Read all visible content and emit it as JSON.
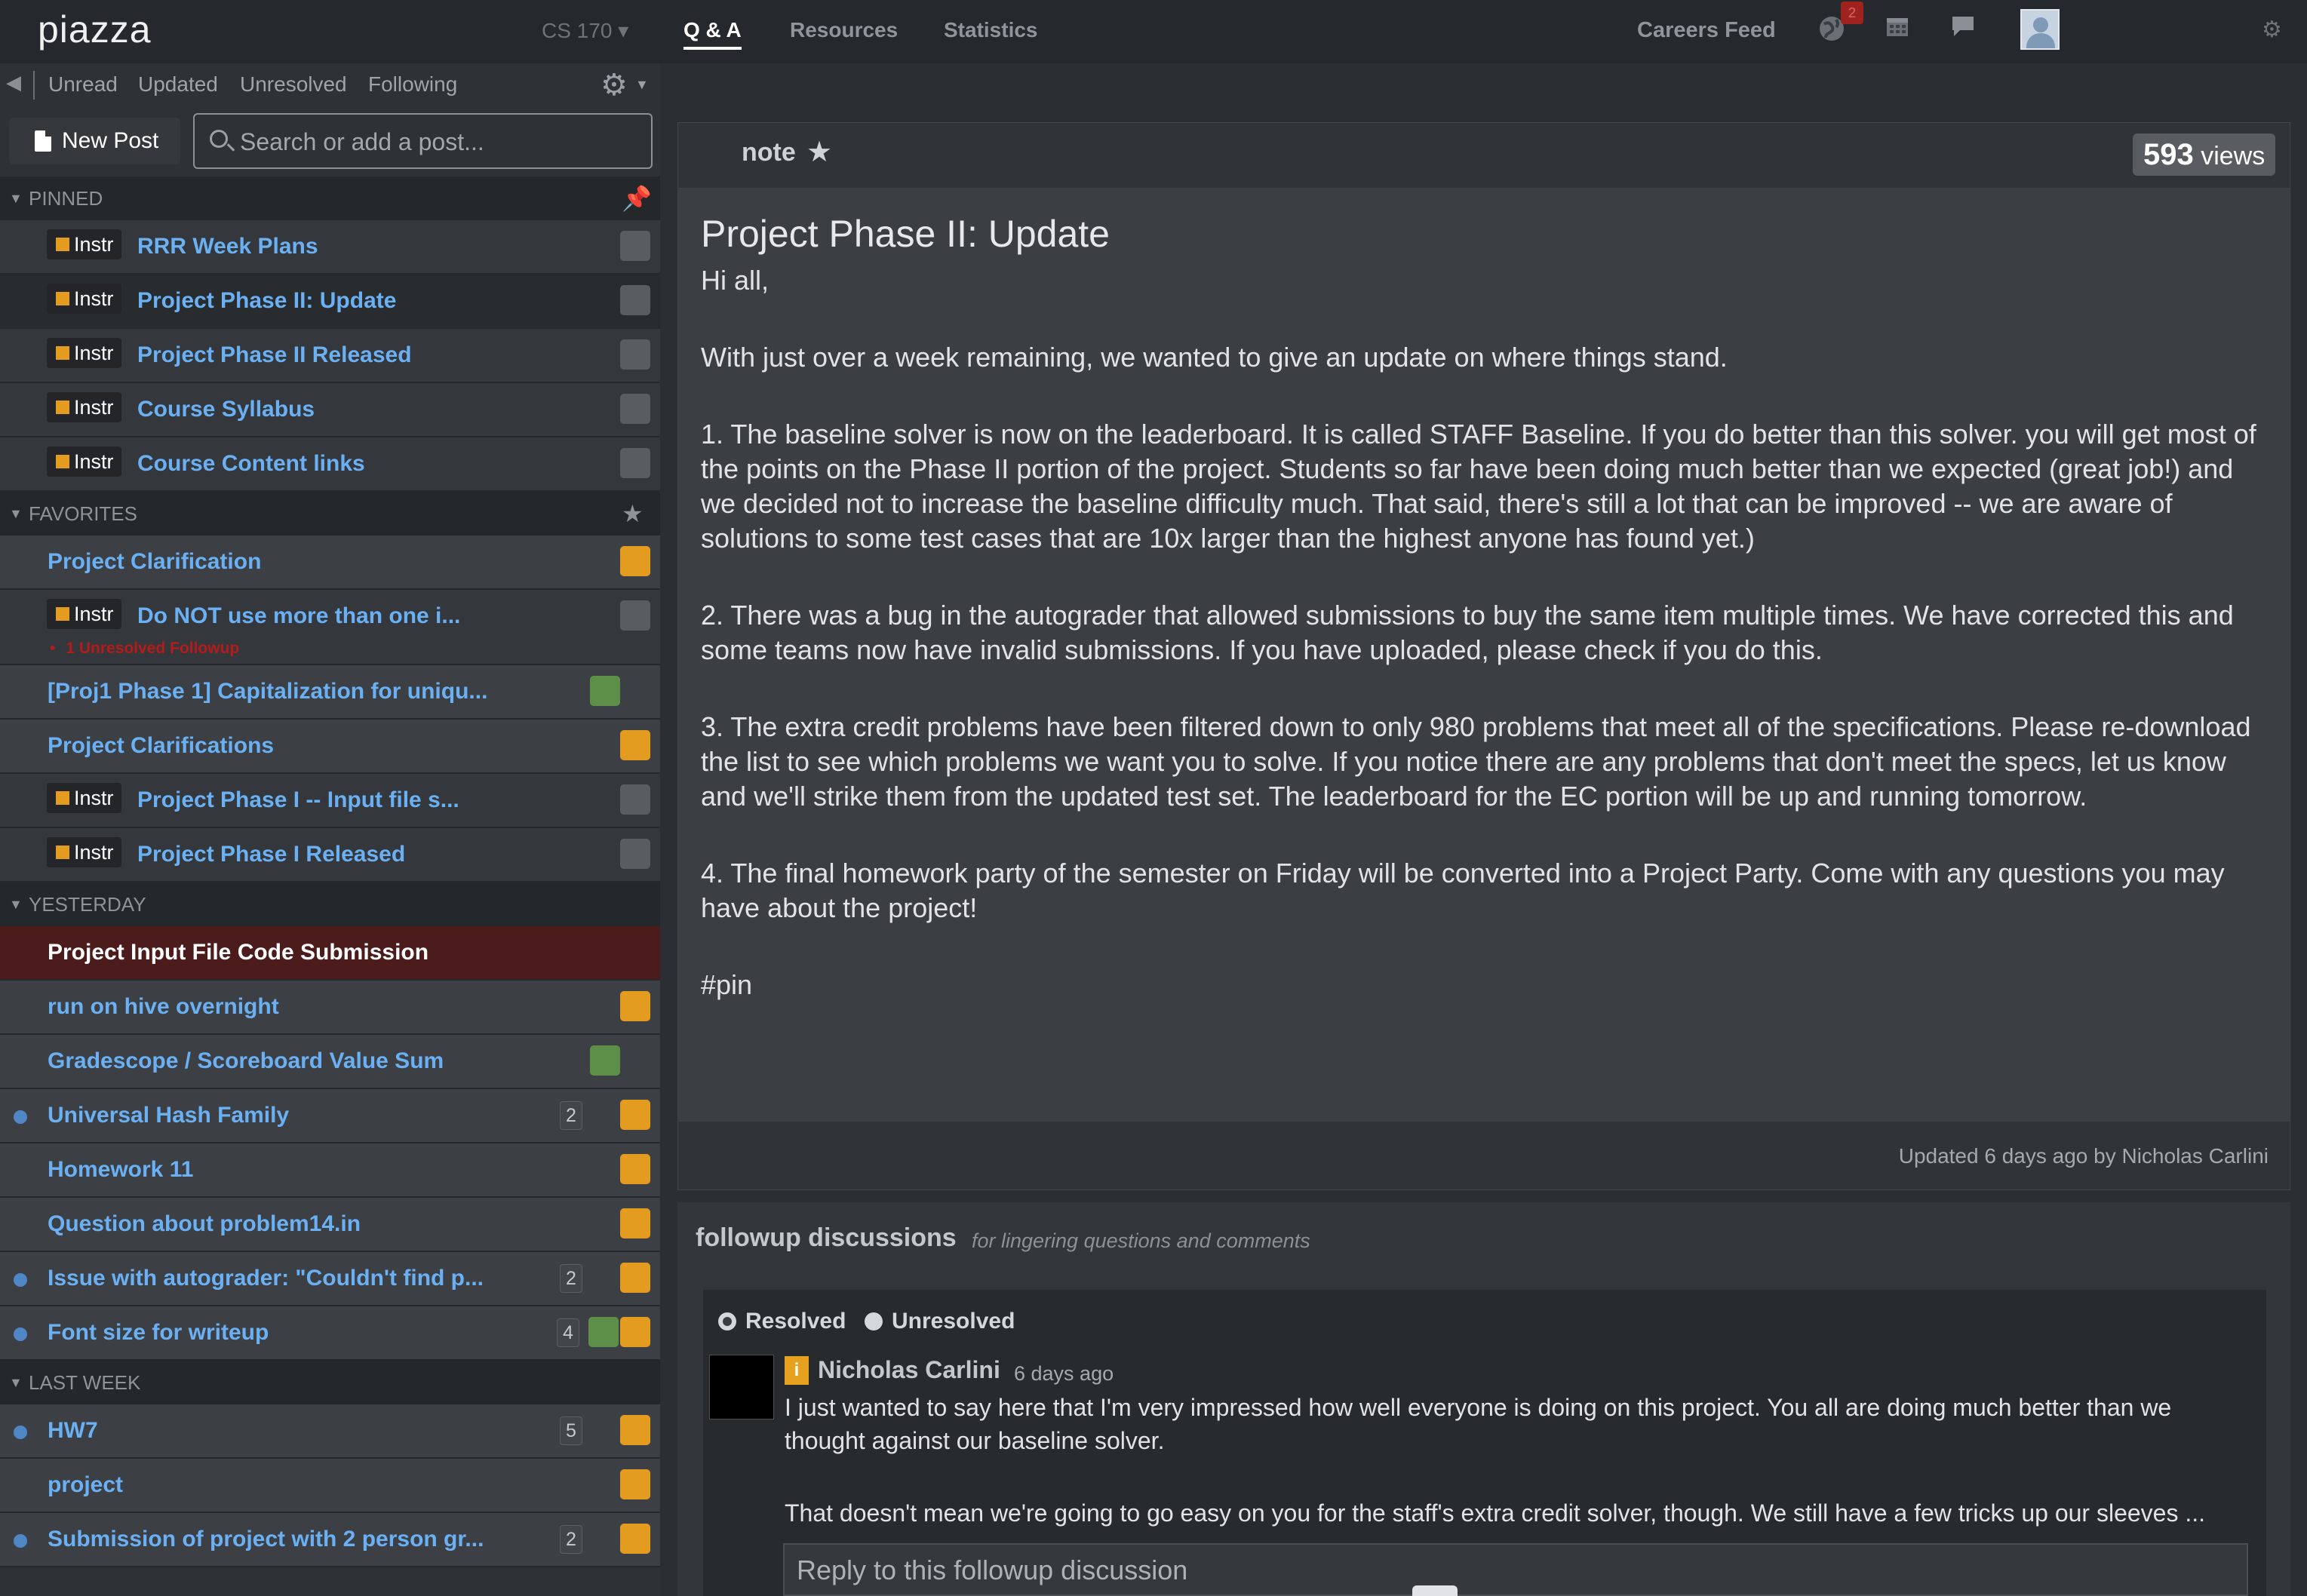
{
  "topnav": {
    "logo": "piazza",
    "course": "CS 170 ▾",
    "tabs": [
      "Q & A",
      "Resources",
      "Statistics"
    ],
    "careers": "Careers Feed",
    "notification_count": "2",
    "icons": [
      "globe-icon",
      "calendar-icon",
      "chat-icon",
      "settings-icon"
    ]
  },
  "filters": {
    "items": [
      "Unread",
      "Updated",
      "Unresolved",
      "Following"
    ]
  },
  "new_post_label": "New Post",
  "search_placeholder": "Search or add a post...",
  "groups": {
    "pinned": "PINNED",
    "favorites": "FAVORITES",
    "yesterday": "YESTERDAY",
    "last_week": "LAST WEEK"
  },
  "instr_label": "Instr",
  "pinned": [
    {
      "title": "RRR Week Plans"
    },
    {
      "title": "Project Phase II: Update"
    },
    {
      "title": "Project Phase II Released"
    },
    {
      "title": "Course Syllabus"
    },
    {
      "title": "Course Content links"
    }
  ],
  "favorites": [
    {
      "title": "Project Clarification"
    },
    {
      "title": "Do NOT use more than one i...",
      "warn": "1 Unresolved Followup"
    },
    {
      "title": "[Proj1 Phase 1] Capitalization for uniqu..."
    },
    {
      "title": "Project Clarifications"
    },
    {
      "title": "Project Phase I -- Input file s..."
    },
    {
      "title": "Project Phase I Released"
    }
  ],
  "yesterday": [
    {
      "title": "Project Input File Code Submission"
    },
    {
      "title": "run on hive overnight"
    },
    {
      "title": "Gradescope / Scoreboard Value Sum"
    },
    {
      "title": "Universal Hash Family",
      "count": "2"
    },
    {
      "title": "Homework 11"
    },
    {
      "title": "Question about problem14.in"
    },
    {
      "title": "Issue with autograder: \"Couldn't find p...",
      "count": "2"
    },
    {
      "title": "Font size for writeup",
      "count": "4"
    }
  ],
  "last_week": [
    {
      "title": "HW7",
      "count": "5"
    },
    {
      "title": "project"
    },
    {
      "title": "Submission of project with 2 person gr...",
      "count": "2"
    }
  ],
  "post": {
    "type": "note",
    "views_count": "593",
    "views_label": "views",
    "title": "Project Phase II: Update",
    "greeting": "Hi all,",
    "paragraphs": [
      "With just over a week remaining, we wanted to give an update on where things stand.",
      "1. The baseline solver is now on the leaderboard. It is called STAFF Baseline. If you do better than this solver. you will get most of the points on the Phase II portion of the project. Students so far have been doing much better than we expected (great job!) and we decided not to increase the baseline difficulty much. That said, there's still a lot that can be improved -- we are aware of solutions to some test cases that are 10x larger than the highest anyone has found yet.)",
      "2. There was a bug in the autograder that allowed submissions to buy the same item multiple times. We have corrected this and some teams now have invalid submissions. If you have uploaded, please check if you do this.",
      "3. The extra credit problems have been filtered down to only 980 problems that meet all of the specifications. Please re-download the list to see which problems we want you to solve. If you notice there are any problems that don't meet the specs, let us know and we'll strike them from the updated test set. The leaderboard for the EC portion will be up and running tomorrow.",
      "4. The final homework party of the semester on Friday will be converted into a Project Party. Come with any questions you may have about the project!",
      "#pin"
    ],
    "updated": "Updated 6 days ago by Nicholas Carlini"
  },
  "followups": {
    "title": "followup discussions",
    "subtitle": "for lingering questions and comments",
    "resolved": "Resolved",
    "unresolved": "Unresolved",
    "author_badge": "i",
    "author": "Nicholas Carlini",
    "time": "6 days ago",
    "text1": "I just wanted to say here that I'm very impressed how well everyone is doing on this project. You all are doing much better than we thought against our baseline solver.",
    "text2": "That doesn't mean we're going to go easy on you for the staff's extra credit solver, though. We still have a few tricks up our sleeves ...",
    "reply_placeholder": "Reply to this followup discussion"
  },
  "colors": {
    "link": "#6ab0f3",
    "instructor_orange": "#e39b20",
    "good_green": "#5e8f48",
    "unresolved_red": "#b41c1c"
  }
}
